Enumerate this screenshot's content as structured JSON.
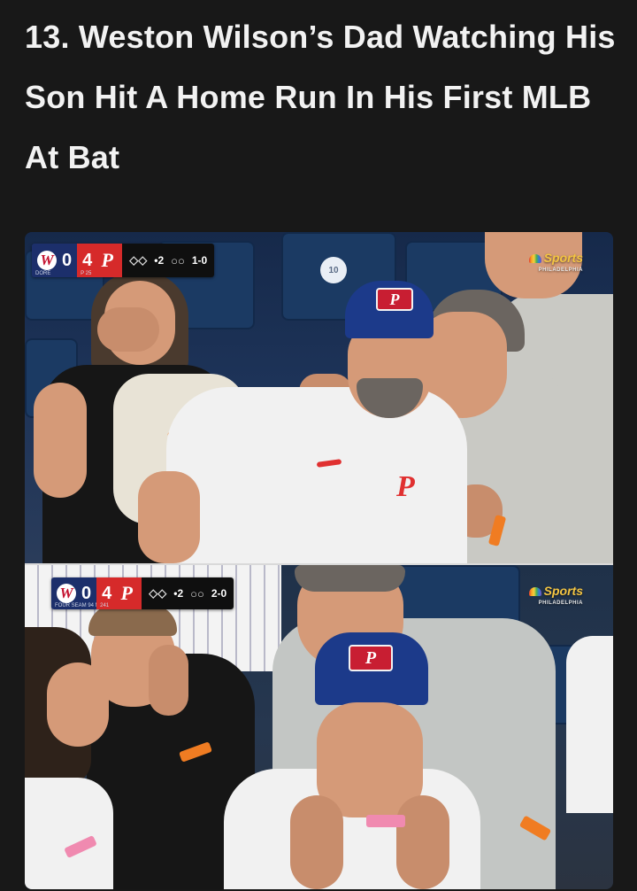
{
  "article": {
    "headline": "13. Weston Wilson’s Dad Watching His Son Hit A Home Run In His First MLB At Bat"
  },
  "media": {
    "top_frame": {
      "scoreboard": {
        "away_score": "0",
        "home_score": "4",
        "away_sub": "DORE",
        "home_sub": "P 25",
        "outs": "•2",
        "count": "1-0"
      },
      "network": {
        "brand": "Sports",
        "region": "PHILADELPHIA"
      },
      "seat_number": "10"
    },
    "bottom_frame": {
      "scoreboard": {
        "away_score": "0",
        "home_score": "4",
        "away_sub": "FOUR SEAM 94 MPH",
        "home_sub": "241",
        "outs": "•2",
        "count": "2-0"
      },
      "network": {
        "brand": "Sports",
        "region": "PHILADELPHIA"
      }
    },
    "cap_letter": "P"
  },
  "colors": {
    "background": "#181818",
    "headline_text": "#f2f2f2",
    "nationals_navy": "#1c2f6b",
    "phillies_red": "#d62a2a",
    "cap_blue": "#1c3a8a"
  }
}
